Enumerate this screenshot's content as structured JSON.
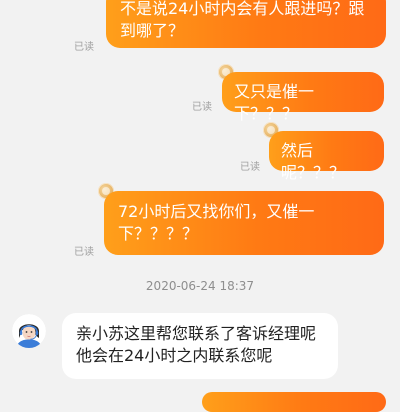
{
  "messages": [
    {
      "id": "m1",
      "from": "user",
      "text": "不是说24小时内会有人跟进吗？跟\n到哪了？",
      "status": "已读"
    },
    {
      "id": "m2",
      "from": "user",
      "text": "又只是催一下？？？",
      "status": "已读"
    },
    {
      "id": "m3",
      "from": "user",
      "text": "然后呢？？？",
      "status": "已读"
    },
    {
      "id": "m4",
      "from": "user",
      "text": "72小时后又找你们，又催一\n下？？？？",
      "status": "已读"
    }
  ],
  "timestamp": "2020-06-24 18:37",
  "agent_message": {
    "text": "亲小苏这里帮您联系了客诉经理呢\n他会在24小时之内联系您呢"
  },
  "colors": {
    "bubble_start": "#ff9f1a",
    "bubble_end": "#ff6a16",
    "background": "#f2f2f2"
  }
}
